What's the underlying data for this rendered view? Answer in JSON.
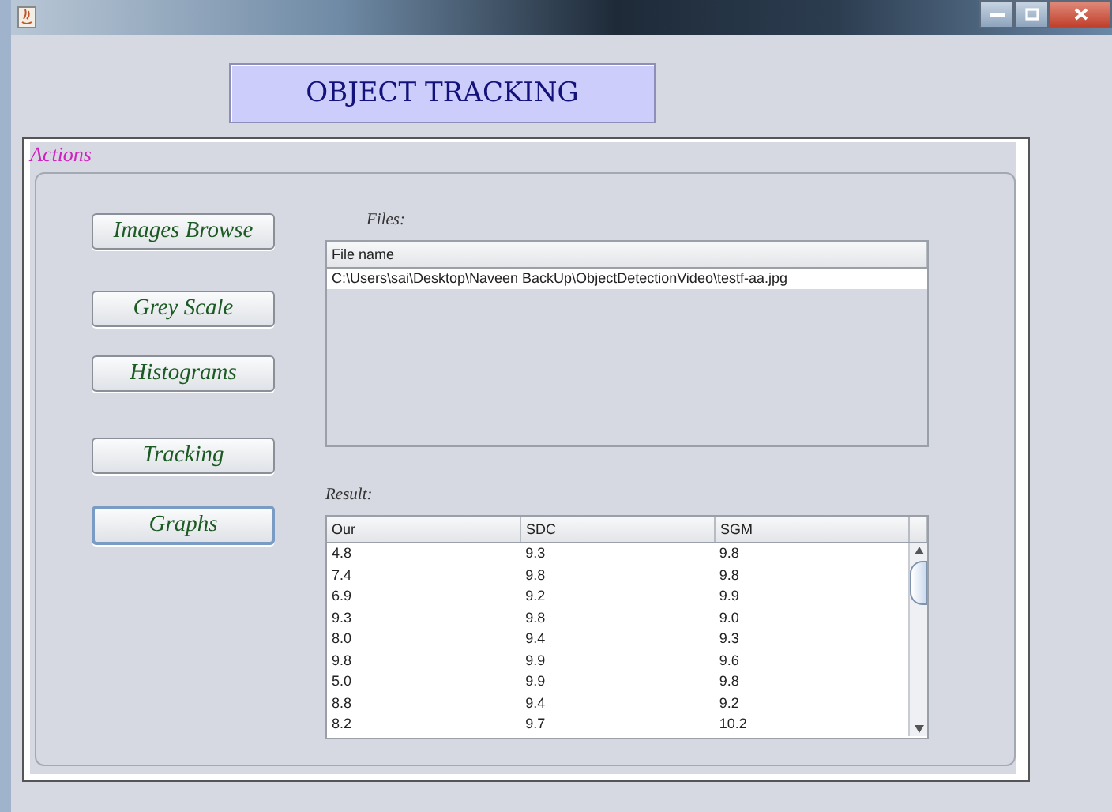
{
  "header": {
    "title": "OBJECT TRACKING"
  },
  "actions": {
    "title": "Actions",
    "buttons": [
      {
        "label": "Images Browse",
        "focused": false
      },
      {
        "label": "Grey Scale",
        "focused": false
      },
      {
        "label": "Histograms",
        "focused": false
      },
      {
        "label": "Tracking",
        "focused": false
      },
      {
        "label": "Graphs",
        "focused": true
      }
    ]
  },
  "files": {
    "label": "Files:",
    "columns": [
      "File name"
    ],
    "rows": [
      [
        "C:\\Users\\sai\\Desktop\\Naveen BackUp\\ObjectDetectionVideo\\testf-aa.jpg"
      ]
    ]
  },
  "result": {
    "label": "Result:",
    "columns": [
      "Our",
      "SDC",
      "SGM"
    ],
    "rows": [
      [
        "4.8",
        "9.3",
        "9.8"
      ],
      [
        "7.4",
        "9.8",
        "9.8"
      ],
      [
        "6.9",
        "9.2",
        "9.9"
      ],
      [
        "9.3",
        "9.8",
        "9.0"
      ],
      [
        "8.0",
        "9.4",
        "9.3"
      ],
      [
        "9.8",
        "9.9",
        "9.6"
      ],
      [
        "5.0",
        "9.9",
        "9.8"
      ],
      [
        "8.8",
        "9.4",
        "9.2"
      ],
      [
        "8.2",
        "9.7",
        "10.2"
      ]
    ]
  }
}
